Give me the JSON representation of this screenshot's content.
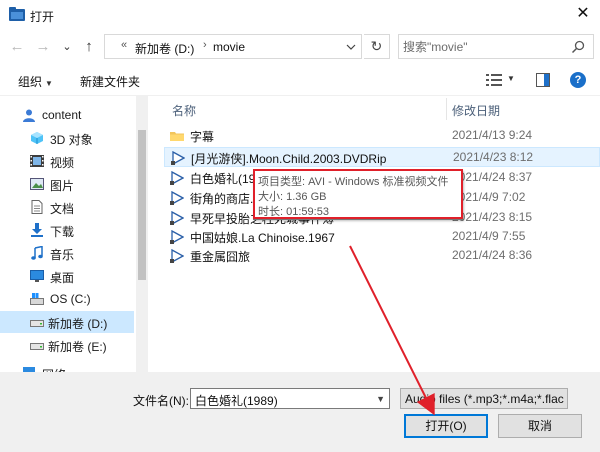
{
  "window": {
    "title": "打开",
    "close_glyph": "✕"
  },
  "nav": {
    "back_glyph": "←",
    "forward_glyph": "→",
    "recent_glyph": "⌄",
    "up_glyph": "↑",
    "address": {
      "lead_sep": "«",
      "crumbs": [
        "新加卷 (D:)",
        "movie"
      ],
      "sep": "›"
    },
    "refresh_glyph": "↻",
    "search_placeholder": "搜索\"movie\""
  },
  "toolbar": {
    "organize": "组织",
    "new_folder": "新建文件夹",
    "caret": "▼",
    "help": "?"
  },
  "sidebar": {
    "items": [
      {
        "label": "content",
        "icon": "user-icon"
      },
      {
        "label": "3D 对象",
        "icon": "cube-3d-icon"
      },
      {
        "label": "视频",
        "icon": "video-icon"
      },
      {
        "label": "图片",
        "icon": "pictures-icon"
      },
      {
        "label": "文档",
        "icon": "documents-icon"
      },
      {
        "label": "下载",
        "icon": "download-icon"
      },
      {
        "label": "音乐",
        "icon": "music-icon"
      },
      {
        "label": "桌面",
        "icon": "desktop-icon"
      },
      {
        "label": "OS (C:)",
        "icon": "windows-drive-icon"
      },
      {
        "label": "新加卷 (D:)",
        "icon": "drive-icon"
      },
      {
        "label": "新加卷 (E:)",
        "icon": "drive-icon"
      },
      {
        "label": "网络",
        "icon": "network-icon"
      }
    ]
  },
  "files": {
    "col_name": "名称",
    "col_date": "修改日期",
    "rows": [
      {
        "name": "字幕",
        "date": "2021/4/13 9:24",
        "icon": "folder-icon"
      },
      {
        "name": "[月光游侠].Moon.Child.2003.DVDRip",
        "date": "2021/4/23 8:12",
        "icon": "video-file-icon"
      },
      {
        "name": "白色婚礼(19",
        "date": "2021/4/24 8:37",
        "icon": "video-file-icon"
      },
      {
        "name": "街角的商店.1",
        "date": "2021/4/9 7:02",
        "icon": "video-file-icon"
      },
      {
        "name": "早死早投胎之枉死城事件簿",
        "date": "2021/4/23 8:15",
        "icon": "video-file-icon"
      },
      {
        "name": "中国姑娘.La Chinoise.1967",
        "date": "2021/4/9 7:55",
        "icon": "video-file-icon"
      },
      {
        "name": "重金属囧旅",
        "date": "2021/4/24 8:36",
        "icon": "video-file-icon"
      }
    ]
  },
  "tooltip": {
    "type": "项目类型: AVI - Windows 标准视频文件",
    "size": "大小: 1.36 GB",
    "duration": "时长: 01:59:53"
  },
  "bottom": {
    "filename_label": "文件名(N):",
    "filename_value": "白色婚礼(1989)",
    "filetype_value": "Audio files (*.mp3;*.m4a;*.flac",
    "open_button": "打开(O)",
    "cancel_button": "取消"
  },
  "colors": {
    "accent": "#0078d7",
    "selection": "#cce8ff",
    "annotation": "#e0202a",
    "help": "#1a6fc9"
  }
}
